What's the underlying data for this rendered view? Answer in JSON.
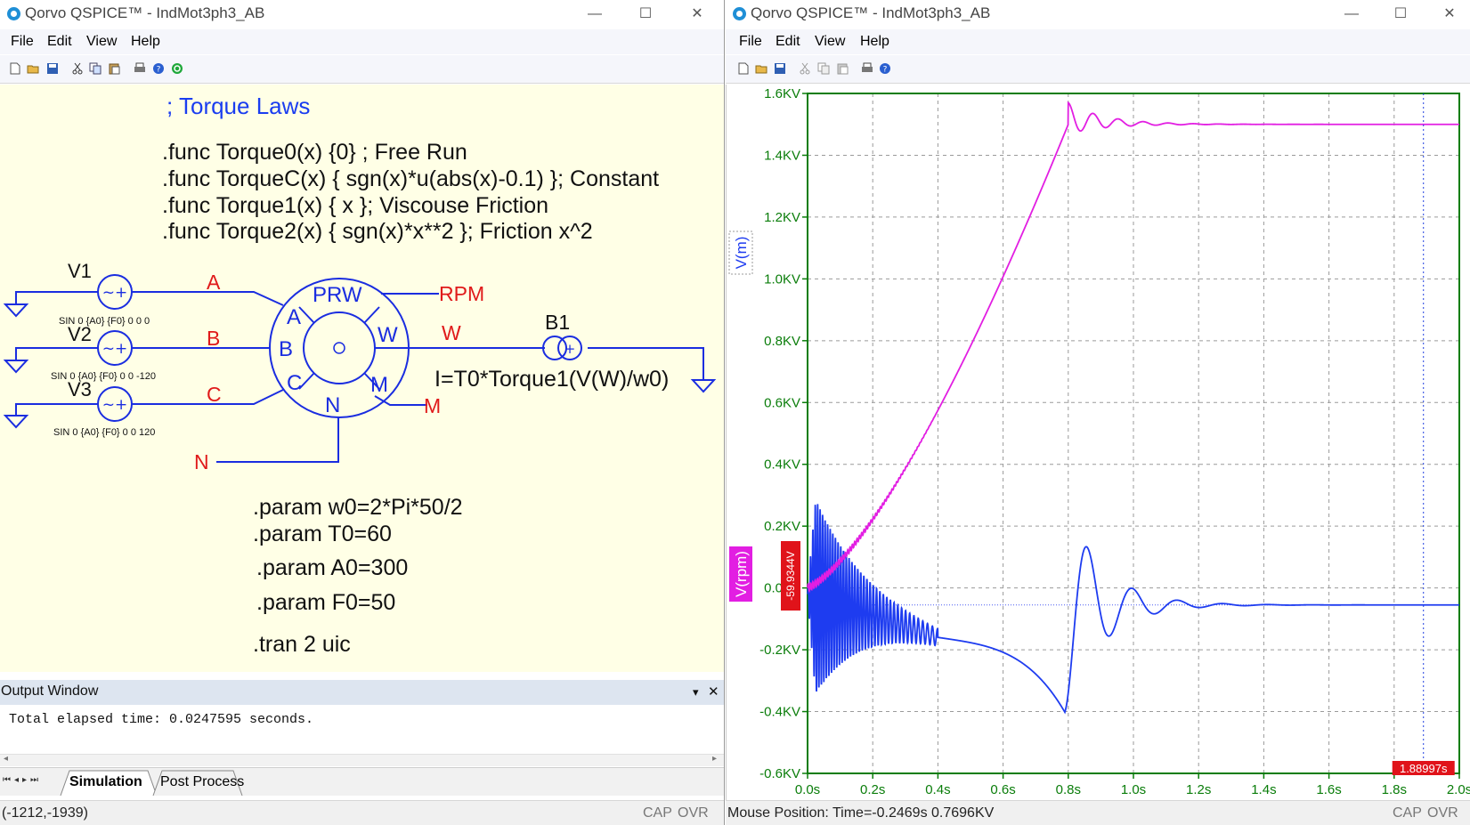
{
  "left_window": {
    "title": "Qorvo QSPICE™ - IndMot3ph3_AB",
    "menu": [
      "File",
      "Edit",
      "View",
      "Help"
    ],
    "schematic": {
      "comment": "; Torque Laws",
      "funcs": [
        ".func Torque0(x) {0} ; Free Run",
        ".func TorqueC(x) { sgn(x)*u(abs(x)-0.1) }; Constant",
        ".func Torque1(x) { x }; Viscouse Friction",
        ".func Torque2(x) { sgn(x)*x**2 }; Friction x^2"
      ],
      "sources": [
        {
          "name": "V1",
          "spec": "SIN 0 {A0} {F0} 0 0 0",
          "net": "A"
        },
        {
          "name": "V2",
          "spec": "SIN 0 {A0} {F0} 0 0 -120",
          "net": "B"
        },
        {
          "name": "V3",
          "spec": "SIN 0 {A0} {F0} 0 0 120",
          "net": "C"
        }
      ],
      "motor": {
        "label": "PRW",
        "pins": [
          "A",
          "B",
          "C",
          "W",
          "M",
          "N"
        ]
      },
      "net_labels": {
        "rpm": "RPM",
        "w": "W",
        "m": "M",
        "n": "N"
      },
      "b1": {
        "name": "B1",
        "expr": "I=T0*Torque1(V(W)/w0)"
      },
      "params": [
        ".param w0=2*Pi*50/2",
        ".param T0=60",
        ".param A0=300",
        ".param F0=50"
      ],
      "tran": ".tran 2 uic"
    },
    "output": {
      "title": "Output Window",
      "text": "Total elapsed time: 0.0247595 seconds.",
      "tabs": [
        "Simulation",
        "Post Process"
      ],
      "active_tab": "Simulation"
    },
    "status": {
      "coords": "(-1212,-1939)",
      "caps": "CAP",
      "ovr": "OVR"
    }
  },
  "right_window": {
    "title": "Qorvo QSPICE™ - IndMot3ph3_AB",
    "menu": [
      "File",
      "Edit",
      "View",
      "Help"
    ],
    "status": {
      "mouse": "Mouse Position: Time=-0.2469s  0.7696KV",
      "caps": "CAP",
      "ovr": "OVR"
    }
  },
  "chart_data": {
    "type": "line",
    "xlabel": "",
    "ylabel": "",
    "xlim": [
      0,
      2.0
    ],
    "ylim": [
      -0.6,
      1.6
    ],
    "x_ticks": [
      "0.0s",
      "0.2s",
      "0.4s",
      "0.6s",
      "0.8s",
      "1.0s",
      "1.2s",
      "1.4s",
      "1.6s",
      "1.8s",
      "2.0s"
    ],
    "y_ticks": [
      "1.6KV",
      "1.4KV",
      "1.2KV",
      "1.0KV",
      "0.8KV",
      "0.6KV",
      "0.4KV",
      "0.2KV",
      "0.0KV",
      "-0.2KV",
      "-0.4KV",
      "-0.6KV"
    ],
    "grid": true,
    "colors": {
      "vm": "#1e3cf0",
      "vrpm": "#e21ee2",
      "axis": "#0a7d0a",
      "cursor": "#e0131a"
    },
    "cursor": {
      "x": 1.88997,
      "x_label": "1.88997s",
      "y_label": "-59.9344V"
    },
    "series": [
      {
        "name": "V(m)",
        "color": "#1e3cf0",
        "unit": "KV",
        "envelope_peak": 0.37,
        "final": -0.055,
        "dip": {
          "x": 0.79,
          "y": -0.4
        },
        "peak_after": {
          "x": 0.86,
          "y": 0.15
        }
      },
      {
        "name": "V(rpm)",
        "color": "#e21ee2",
        "unit": "KV",
        "final": 1.5,
        "overshoot": {
          "x": 0.85,
          "y": 1.57
        }
      }
    ]
  }
}
